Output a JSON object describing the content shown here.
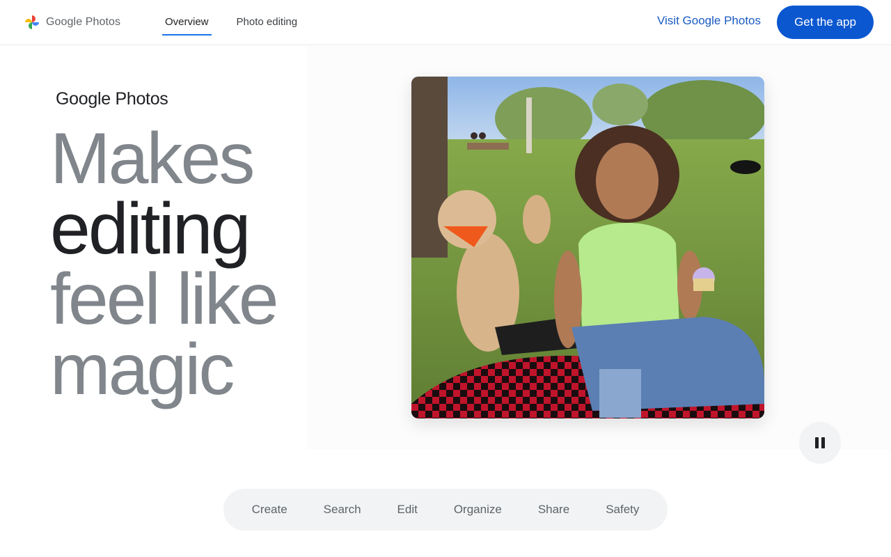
{
  "header": {
    "logo_text": "Google Photos",
    "nav": [
      {
        "label": "Overview",
        "active": true
      },
      {
        "label": "Photo editing",
        "active": false
      }
    ],
    "visit_link": "Visit Google Photos",
    "cta_label": "Get the app"
  },
  "hero": {
    "brand": "Google Photos",
    "headline": [
      "Makes",
      "editing",
      "feel like",
      "magic"
    ],
    "emphasized_word": "editing",
    "media_icon": "pause-icon"
  },
  "tabs": [
    "Create",
    "Search",
    "Edit",
    "Organize",
    "Share",
    "Safety"
  ],
  "colors": {
    "accent": "#0b57d0",
    "link": "#1a5ac2",
    "headline_gray": "#80868b",
    "headline_dark": "#202124",
    "tab_bar": "#f1f3f4"
  }
}
